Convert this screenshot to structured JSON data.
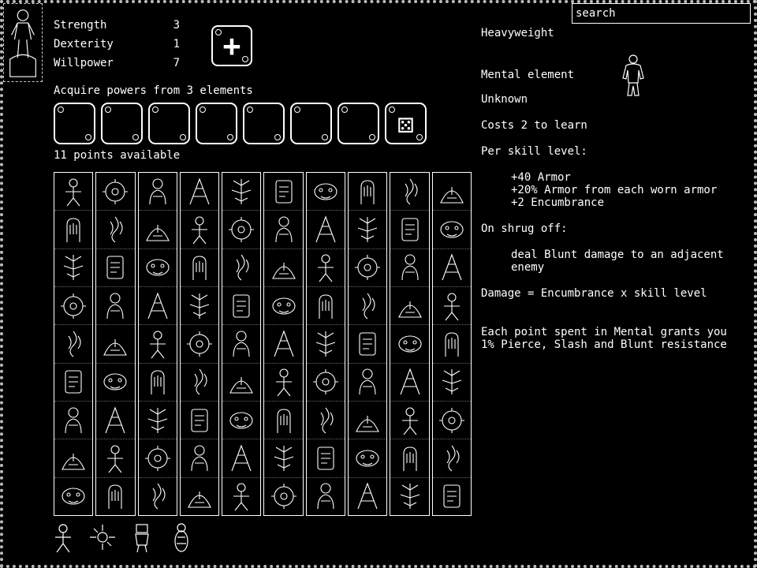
{
  "search": {
    "placeholder": "search"
  },
  "stats": [
    {
      "label": "Strength",
      "value": "3"
    },
    {
      "label": "Dexterity",
      "value": "1"
    },
    {
      "label": "Willpower",
      "value": "7"
    }
  ],
  "acquire_text": "Acquire powers from 3 elements",
  "points_text": "11 points available",
  "details": {
    "name": "Heavyweight",
    "element": "Mental element",
    "status": "Unknown",
    "cost": "Costs 2 to learn",
    "per_level_heading": "Per skill level:",
    "per_level_1": "+40 Armor",
    "per_level_2": "+20% Armor from each worn armor",
    "per_level_3": "+2 Encumbrance",
    "shrug_heading": "On shrug off:",
    "shrug_effect": "deal Blunt damage to an adjacent enemy",
    "damage_formula": "Damage = Encumbrance x skill level",
    "bonus": "Each point spent in Mental grants you 1% Pierce, Slash and Blunt resistance"
  }
}
